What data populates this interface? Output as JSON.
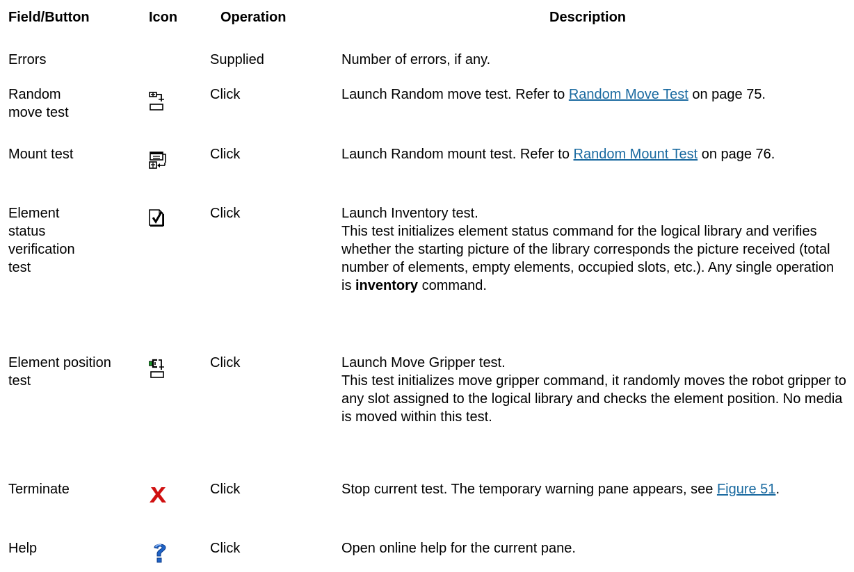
{
  "headers": {
    "field": "Field/Button",
    "icon": "Icon",
    "operation": "Operation",
    "description": "Description"
  },
  "rows": [
    {
      "field": "Errors",
      "icon": "",
      "operation": "Supplied",
      "description": "Number of errors, if any."
    },
    {
      "field": "Random move test",
      "icon": "random-move-icon",
      "operation": "Click",
      "desc_before": "Launch Random move test. Refer to ",
      "desc_link": "Random Move Test",
      "desc_after": " on page 75."
    },
    {
      "field": "Mount test",
      "icon": "random-mount-icon",
      "operation": "Click",
      "desc_before": "Launch Random mount test. Refer to ",
      "desc_link": "Random Mount Test",
      "desc_after": " on page 76."
    },
    {
      "field": "Element status verification test",
      "icon": "inventory-check-icon",
      "operation": "Click",
      "desc_line1": "Launch Inventory test.",
      "desc_line2": "This test initializes element status command for the logical library and verifies whether the starting picture of the library corresponds the picture received (total number of elements, empty elements, occupied slots, etc.). Any single operation is ",
      "desc_bold": "inventory",
      "desc_after": " command."
    },
    {
      "field": "Element position test",
      "icon": "move-gripper-icon",
      "operation": "Click",
      "desc_line1": "Launch Move Gripper test.",
      "desc_line2": "This test initializes move gripper command, it randomly moves the robot gripper to any slot assigned to the logical library and checks the element position. No media is moved within this test."
    },
    {
      "field": "Terminate",
      "icon": "close-x-icon",
      "operation": "Click",
      "desc_before": "Stop current test. The temporary warning pane appears, see ",
      "desc_link": "Figure 51",
      "desc_after": "."
    },
    {
      "field": "Help",
      "icon": "help-question-icon",
      "operation": "Click",
      "description": "Open online help for the current pane."
    }
  ],
  "colors": {
    "link": "#1a6aa0",
    "terminate_icon": "#d01010",
    "help_icon": "#1f63c6"
  }
}
